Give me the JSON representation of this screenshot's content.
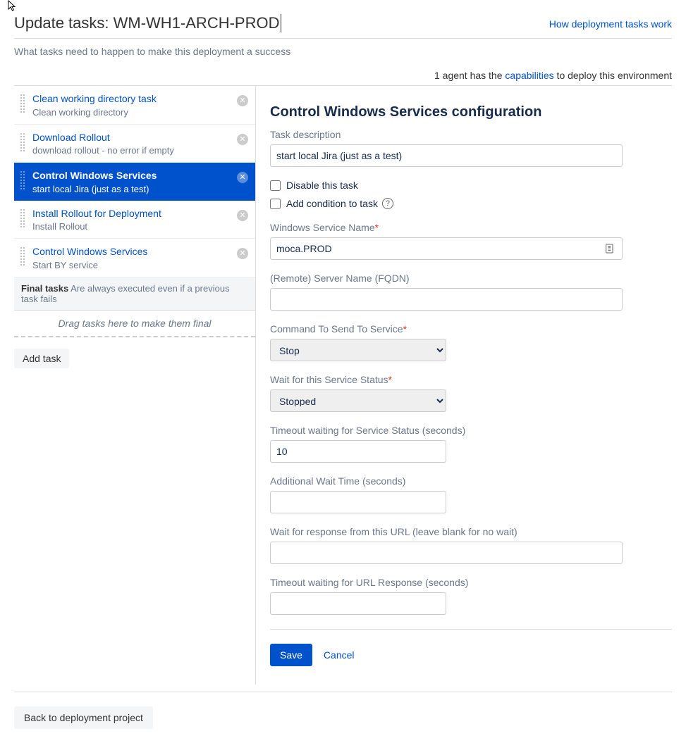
{
  "header": {
    "title": "Update tasks: WM-WH1-ARCH-PROD",
    "help_link": "How deployment tasks work",
    "subtitle": "What tasks need to happen to make this deployment a success",
    "agent_prefix": "1 agent has the ",
    "agent_cap": "capabilities",
    "agent_suffix": " to deploy this environment"
  },
  "tasks": [
    {
      "title": "Clean working directory task",
      "desc": "Clean working directory",
      "selected": false
    },
    {
      "title": "Download Rollout",
      "desc": "download rollout - no error if empty",
      "selected": false
    },
    {
      "title": "Control Windows Services",
      "desc": "start local Jira (just as a test)",
      "selected": true
    },
    {
      "title": "Install Rollout for Deployment",
      "desc": "Install Rollout",
      "selected": false
    },
    {
      "title": "Control Windows Services",
      "desc": "Start BY service",
      "selected": false
    }
  ],
  "final_tasks": {
    "label": "Final tasks",
    "note": "Are always executed even if a previous task fails",
    "drop_hint": "Drag tasks here to make them final"
  },
  "add_task_label": "Add task",
  "config": {
    "title": "Control Windows Services configuration",
    "description_label": "Task description",
    "description_value": "start local Jira (just as a test)",
    "disable_label": "Disable this task",
    "condition_label": "Add condition to task",
    "service_name_label": "Windows Service Name",
    "service_name_value": "moca.PROD",
    "remote_label": "(Remote) Server Name (FQDN)",
    "remote_value": "",
    "command_label": "Command To Send To Service",
    "command_value": "Stop",
    "wait_status_label": "Wait for this Service Status",
    "wait_status_value": "Stopped",
    "timeout_status_label": "Timeout waiting for Service Status (seconds)",
    "timeout_status_value": "10",
    "add_wait_label": "Additional Wait Time (seconds)",
    "add_wait_value": "",
    "wait_url_label": "Wait for response from this URL (leave blank for no wait)",
    "wait_url_value": "",
    "timeout_url_label": "Timeout waiting for URL Response (seconds)",
    "timeout_url_value": "",
    "save_label": "Save",
    "cancel_label": "Cancel"
  },
  "footer": {
    "back_label": "Back to deployment project"
  }
}
